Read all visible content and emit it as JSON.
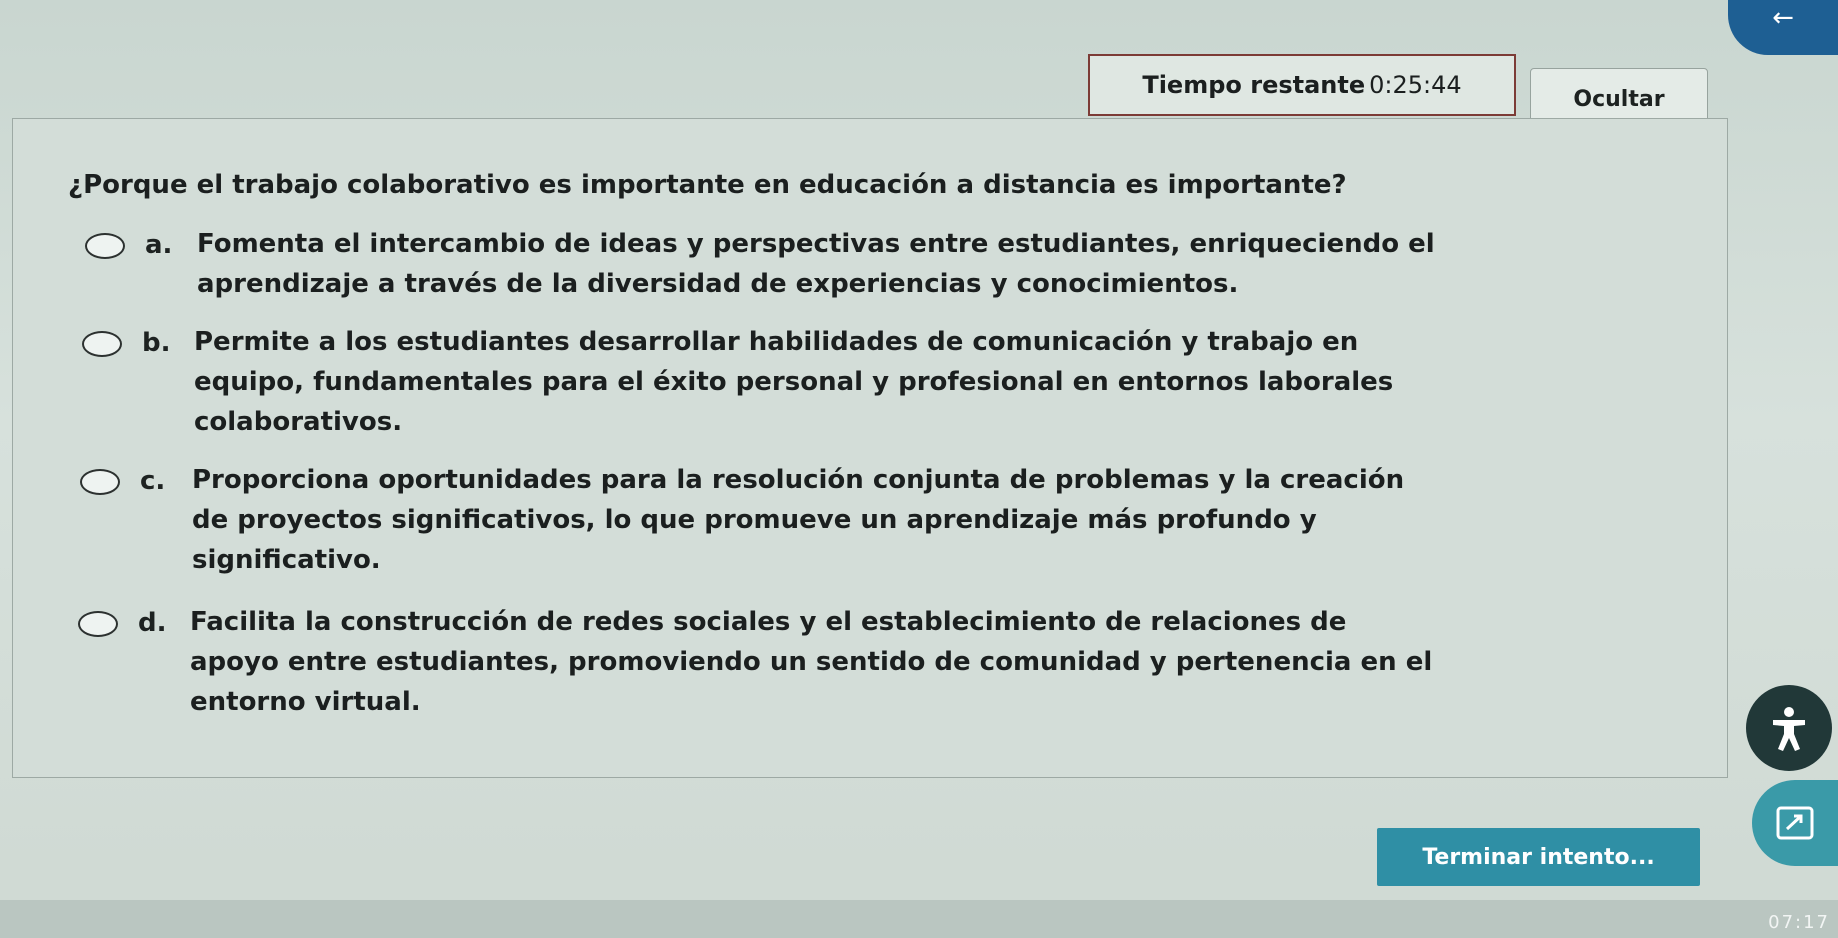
{
  "nav": {
    "back_icon": "←",
    "back_icon_name": "arrow-left-icon"
  },
  "timer": {
    "label": "Tiempo restante",
    "value": "0:25:44"
  },
  "hide_button": {
    "label": "Ocultar"
  },
  "question": {
    "text": "¿Porque el trabajo colaborativo es importante en educación a distancia es importante?",
    "options": [
      {
        "letter": "a.",
        "lines": [
          "Fomenta el intercambio de ideas y perspectivas entre estudiantes, enriqueciendo el",
          "aprendizaje a través de la diversidad de experiencias y conocimientos."
        ]
      },
      {
        "letter": "b.",
        "lines": [
          "Permite a los estudiantes desarrollar habilidades de comunicación y trabajo en",
          "equipo, fundamentales para el éxito personal y profesional en entornos laborales",
          "colaborativos."
        ]
      },
      {
        "letter": "c.",
        "lines": [
          "Proporciona oportunidades para la resolución conjunta de problemas y la creación",
          "de proyectos significativos, lo que promueve un aprendizaje más profundo y",
          "significativo."
        ]
      },
      {
        "letter": "d.",
        "lines": [
          "Facilita la construcción de redes sociales y el establecimiento de relaciones de",
          "apoyo entre estudiantes, promoviendo un sentido de comunidad y pertenencia en el",
          "entorno virtual."
        ]
      }
    ]
  },
  "finish_button": {
    "label": "Terminar intento..."
  },
  "footer": {
    "time": "07:17"
  },
  "colors": {
    "accent": "#2f8fa5",
    "timer_border": "#7c3b36",
    "nav": "#1e5f93"
  }
}
